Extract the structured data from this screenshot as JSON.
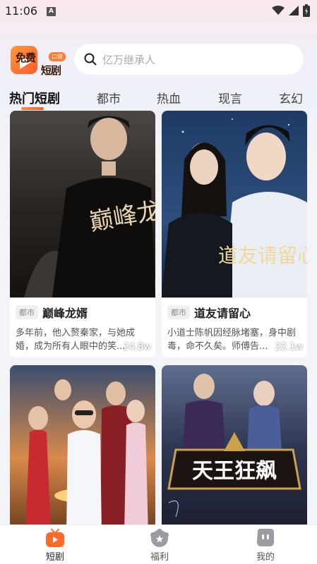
{
  "status_bar": {
    "time": "11:06",
    "notification_letter": "A"
  },
  "header": {
    "logo_line1": "免费",
    "logo_line2": "短剧",
    "logo_badge": "口袋",
    "search_placeholder": "亿万继承人"
  },
  "tabs": [
    {
      "label": "热门短剧",
      "active": true
    },
    {
      "label": "都市",
      "active": false
    },
    {
      "label": "热血",
      "active": false
    },
    {
      "label": "现言",
      "active": false
    },
    {
      "label": "玄幻",
      "active": false
    }
  ],
  "cards": [
    {
      "tag": "都市",
      "title": "巅峰龙婿",
      "desc": "多年前，他入赘秦家，与她成婚，成为所有人眼中的笑...",
      "views": "24.8w",
      "poster_text": "巅峰龙婿"
    },
    {
      "tag": "都市",
      "title": "道友请留心",
      "desc": "小道士陈帆因经脉堵塞，身中剧毒，命不久矣。师傅告...",
      "views": "22.1w",
      "poster_text": "道友请留心"
    },
    {
      "poster_text": ""
    },
    {
      "poster_text": "天王狂飙"
    }
  ],
  "bottom_nav": [
    {
      "label": "短剧",
      "icon": "tv-icon",
      "active": true
    },
    {
      "label": "福利",
      "icon": "gift-icon",
      "active": false
    },
    {
      "label": "我的",
      "icon": "profile-icon",
      "active": false
    }
  ],
  "colors": {
    "accent": "#ff6a2b",
    "background": "#f3f4f7"
  }
}
